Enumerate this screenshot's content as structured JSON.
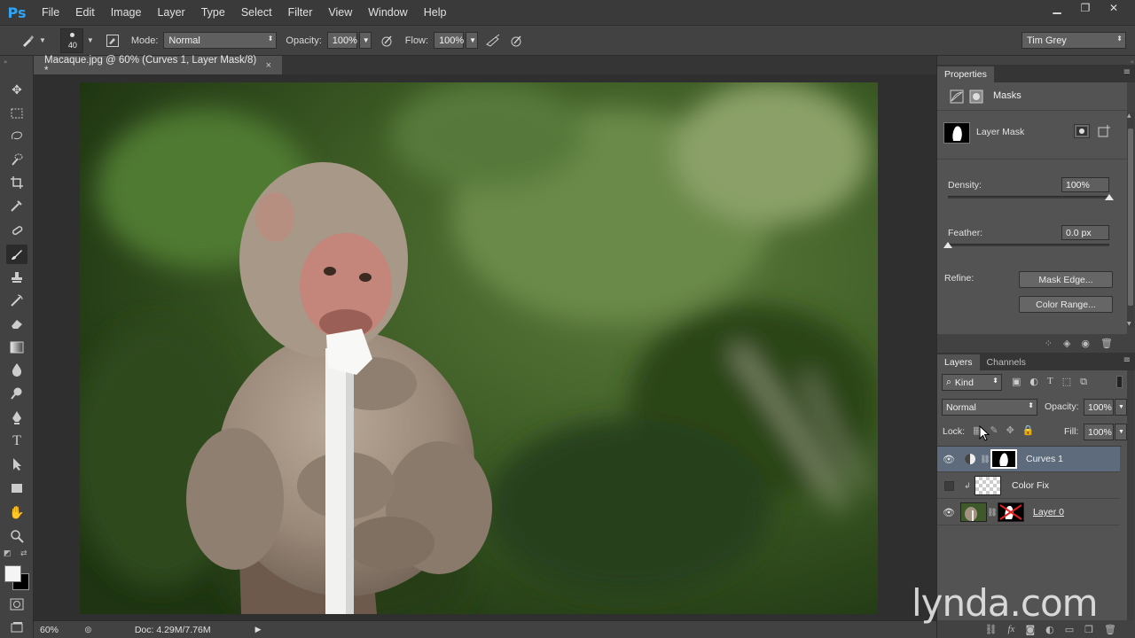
{
  "app": {
    "logo": "Ps",
    "menus": [
      "File",
      "Edit",
      "Image",
      "Layer",
      "Type",
      "Select",
      "Filter",
      "View",
      "Window",
      "Help"
    ]
  },
  "window_controls": {
    "minimize": "▁",
    "restore": "❐",
    "close": "✕"
  },
  "options": {
    "brush_size": "40",
    "mode_label": "Mode:",
    "mode_value": "Normal",
    "opacity_label": "Opacity:",
    "opacity_value": "100%",
    "flow_label": "Flow:",
    "flow_value": "100%",
    "workspace": "Tim Grey"
  },
  "document": {
    "tab_title": "Macaque.jpg @ 60% (Curves 1, Layer Mask/8) *",
    "close": "×",
    "zoom": "60%",
    "doc_info": "Doc: 4.29M/7.76M"
  },
  "properties": {
    "tab": "Properties",
    "section": "Masks",
    "mask_type": "Layer Mask",
    "density_label": "Density:",
    "density_value": "100%",
    "density_level": 1.0,
    "feather_label": "Feather:",
    "feather_value": "0.0 px",
    "feather_level": 0.0,
    "refine_label": "Refine:",
    "mask_edge_button": "Mask Edge...",
    "color_range_button": "Color Range..."
  },
  "layers_panel": {
    "tabs": [
      "Layers",
      "Channels"
    ],
    "filter_kind": "Kind",
    "blend_mode": "Normal",
    "opacity_label": "Opacity:",
    "opacity_value": "100%",
    "lock_label": "Lock:",
    "fill_label": "Fill:",
    "fill_value": "100%",
    "layers": [
      {
        "name": "Curves 1",
        "visible": true,
        "selected": true
      },
      {
        "name": "Color Fix",
        "visible": false,
        "selected": false
      },
      {
        "name": "Layer 0",
        "visible": true,
        "selected": false
      }
    ]
  },
  "watermark": "lynda.com",
  "colors": {
    "accent": "#2fa3f5",
    "selection": "#5d6b7d",
    "panel_bg": "#535353"
  }
}
